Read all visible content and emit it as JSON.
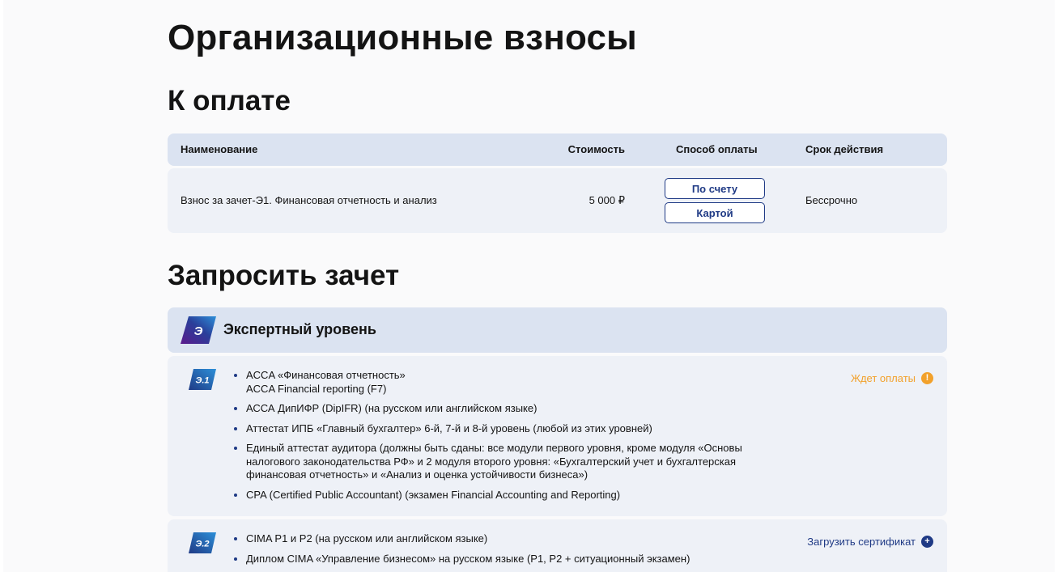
{
  "page_title": "Организационные взносы",
  "payment": {
    "title": "К оплате",
    "columns": {
      "name": "Наименование",
      "price": "Стоимость",
      "method": "Способ оплаты",
      "term": "Срок действия"
    },
    "rows": [
      {
        "name": "Взнос за зачет-Э1. Финансовая отчетность и анализ",
        "price": "5 000 ₽",
        "btn_invoice": "По счету",
        "btn_card": "Картой",
        "term": "Бессрочно"
      }
    ]
  },
  "request": {
    "title": "Запросить зачет",
    "level": {
      "badge": "Э",
      "title": "Экспертный уровень"
    },
    "modules": [
      {
        "badge": "Э.1",
        "status": "Ждет оплаты",
        "items": [
          [
            "ACCA «Финансовая отчетность»",
            "ACCA Financial reporting (F7)"
          ],
          [
            "АССА ДипИФР (DipIFR) (на русском или английском языке)"
          ],
          [
            "Аттестат ИПБ «Главный бухгалтер» 6-й, 7-й и 8-й уровень (любой из этих уровней)"
          ],
          [
            "Единый аттестат аудитора (должны быть сданы: все модули первого уровня, кроме модуля «Основы",
            "налогового законодательства РФ» и 2 модуля второго уровня: «Бухгалтерский учет и бухгалтерская",
            "финансовая отчетность» и «Анализ и оценка устойчивости бизнеса»)"
          ],
          [
            "CPA (Certified Public Accountant) (экзамен Financial Accounting and Reporting)"
          ]
        ]
      },
      {
        "badge": "Э.2",
        "status": "Загрузить сертификат",
        "items": [
          [
            "CIMA P1 и P2 (на русском или английском языке)"
          ],
          [
            "Диплом CIMA «Управление бизнесом» на русском языке (P1, P2 + ситуационный экзамен)"
          ]
        ]
      }
    ]
  },
  "colors": {
    "accent": "#1f3a85",
    "header_bg": "#dbe3f1",
    "row_bg": "#eef1f7",
    "warning": "#f2a12b"
  }
}
